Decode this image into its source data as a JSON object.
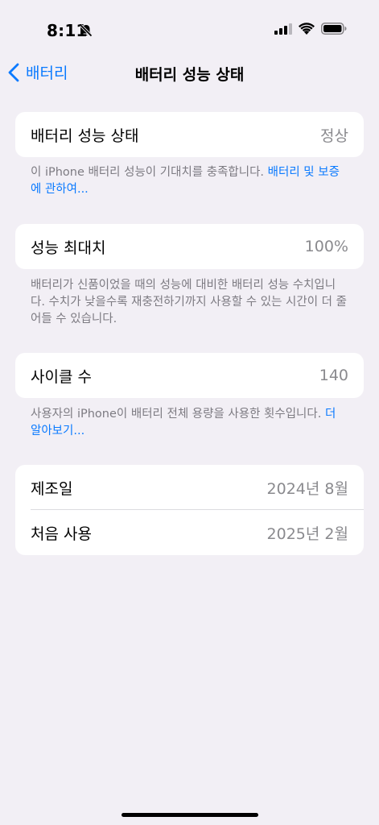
{
  "status_bar": {
    "time": "8:11"
  },
  "nav": {
    "back_label": "배터리",
    "title": "배터리 성능 상태"
  },
  "battery_health": {
    "label": "배터리 성능 상태",
    "value": "정상",
    "footnote": "이 iPhone 배터리 성능이 기대치를 충족합니다. ",
    "footnote_link": "배터리 및 보증에 관하여..."
  },
  "max_capacity": {
    "label": "성능 최대치",
    "value": "100%",
    "footnote": "배터리가 신품이었을 때의 성능에 대비한 배터리 성능 수치입니다. 수치가 낮을수록 재충전하기까지 사용할 수 있는 시간이 더 줄어들 수 있습니다."
  },
  "cycle_count": {
    "label": "사이클 수",
    "value": "140",
    "footnote": "사용자의 iPhone이 배터리 전체 용량을 사용한 횟수입니다. ",
    "footnote_link": "더 알아보기..."
  },
  "dates": {
    "manufacture_label": "제조일",
    "manufacture_value": "2024년 8월",
    "first_use_label": "처음 사용",
    "first_use_value": "2025년 2월"
  },
  "colors": {
    "background": "#f2eff5",
    "accent": "#0a7aff",
    "secondary_text": "#8a8a8e"
  },
  "icons": [
    "silent-bell-icon",
    "cellular-signal-icon",
    "wifi-icon",
    "battery-icon",
    "chevron-left-icon"
  ]
}
